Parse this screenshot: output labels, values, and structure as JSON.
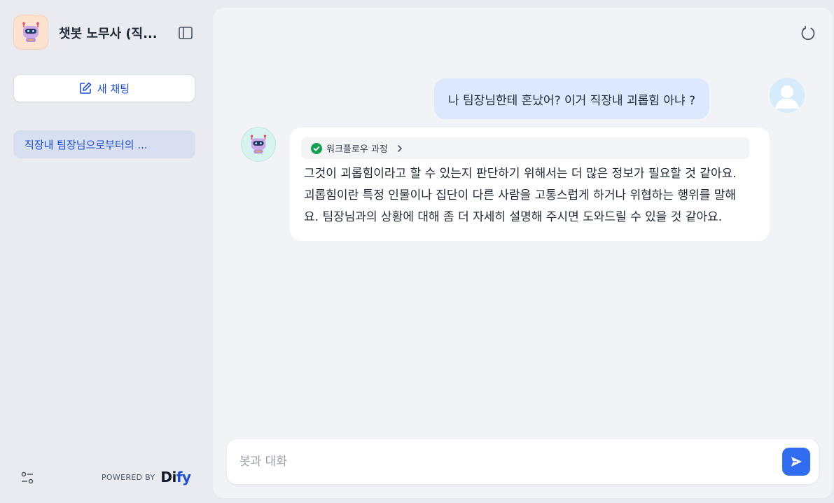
{
  "sidebar": {
    "app_title": "챗봇 노무사 (직...",
    "new_chat_label": "새 채팅",
    "conversations": [
      {
        "label": "직장내 팀장님으로부터의 ..."
      }
    ],
    "powered_by": "POWERED BY",
    "brand": {
      "prefix": "Di",
      "suffix": "fy"
    }
  },
  "chat": {
    "messages": [
      {
        "role": "user",
        "text": "나 팀장님한테 혼났어? 이거 직장내 괴롭힘 아냐 ?"
      },
      {
        "role": "assistant",
        "workflow_label": "워크플로우 과정",
        "text": "그것이 괴롭힘이라고 할 수 있는지 판단하기 위해서는 더 많은 정보가 필요할 것 같아요. 괴롭힘이란 특정 인물이나 집단이 다른 사람을 고통스럽게 하거나 위협하는 행위를 말해요. 팀장님과의 상황에 대해 좀 더 자세히 설명해 주시면 도와드릴 수 있을 것 같아요."
      }
    ],
    "input": {
      "placeholder": "봇과 대화",
      "value": ""
    }
  },
  "colors": {
    "accent": "#2f6cf0",
    "user_bubble": "#dbe8fe",
    "active_conversation": "#d8dff0",
    "workflow_success": "#12a150"
  },
  "icons": {
    "app_avatar": "robot-icon",
    "collapse": "sidebar-toggle-icon",
    "new_chat": "edit-icon",
    "settings": "sliders-icon",
    "refresh": "refresh-icon",
    "user_avatar": "user-icon",
    "bot_avatar": "robot-icon",
    "workflow_status": "check-circle-icon",
    "workflow_expand": "chevron-right-icon",
    "send": "send-icon"
  }
}
